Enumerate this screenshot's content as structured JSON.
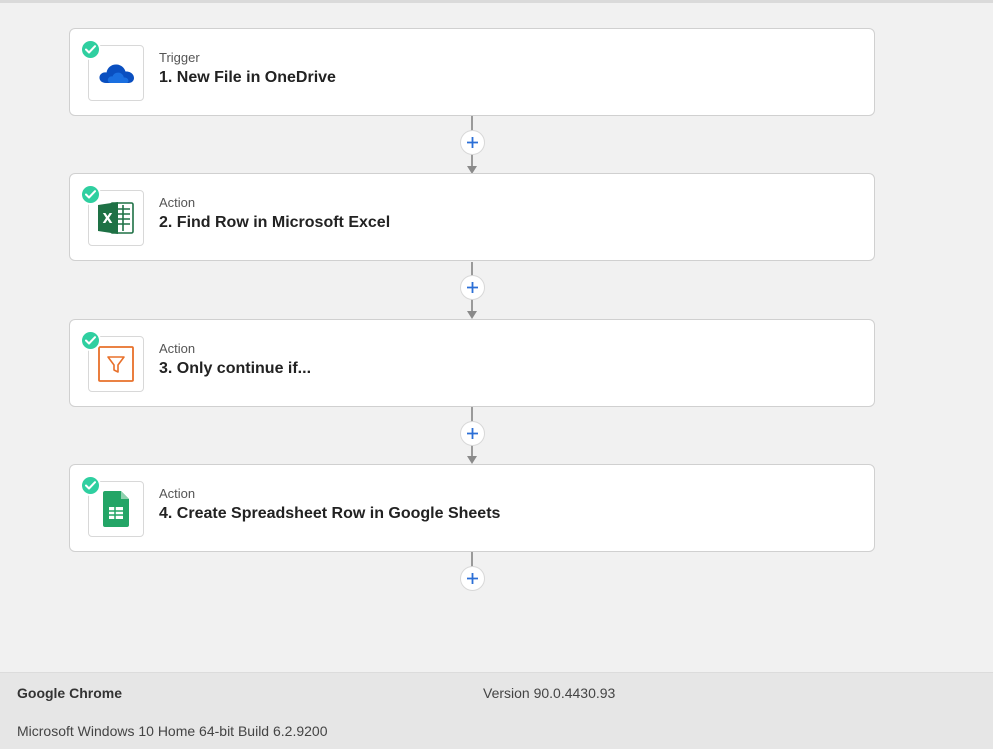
{
  "steps": [
    {
      "type": "Trigger",
      "title": "1. New File in OneDrive",
      "icon": "onedrive-icon",
      "status": "complete"
    },
    {
      "type": "Action",
      "title": "2. Find Row in Microsoft Excel",
      "icon": "excel-icon",
      "status": "complete"
    },
    {
      "type": "Action",
      "title": "3. Only continue if...",
      "icon": "filter-icon",
      "status": "complete"
    },
    {
      "type": "Action",
      "title": "4. Create Spreadsheet Row in Google Sheets",
      "icon": "google-sheets-icon",
      "status": "complete"
    }
  ],
  "footer": {
    "browser": "Google Chrome",
    "version": "Version 90.0.4430.93",
    "os": "Microsoft Windows 10 Home 64-bit Build 6.2.9200"
  },
  "colors": {
    "check": "#2fcfa0",
    "plus": "#2b6fd6",
    "onedrive": "#0a4fc0",
    "excel": "#1e7145",
    "filter": "#e8702a",
    "sheets": "#23a566"
  }
}
